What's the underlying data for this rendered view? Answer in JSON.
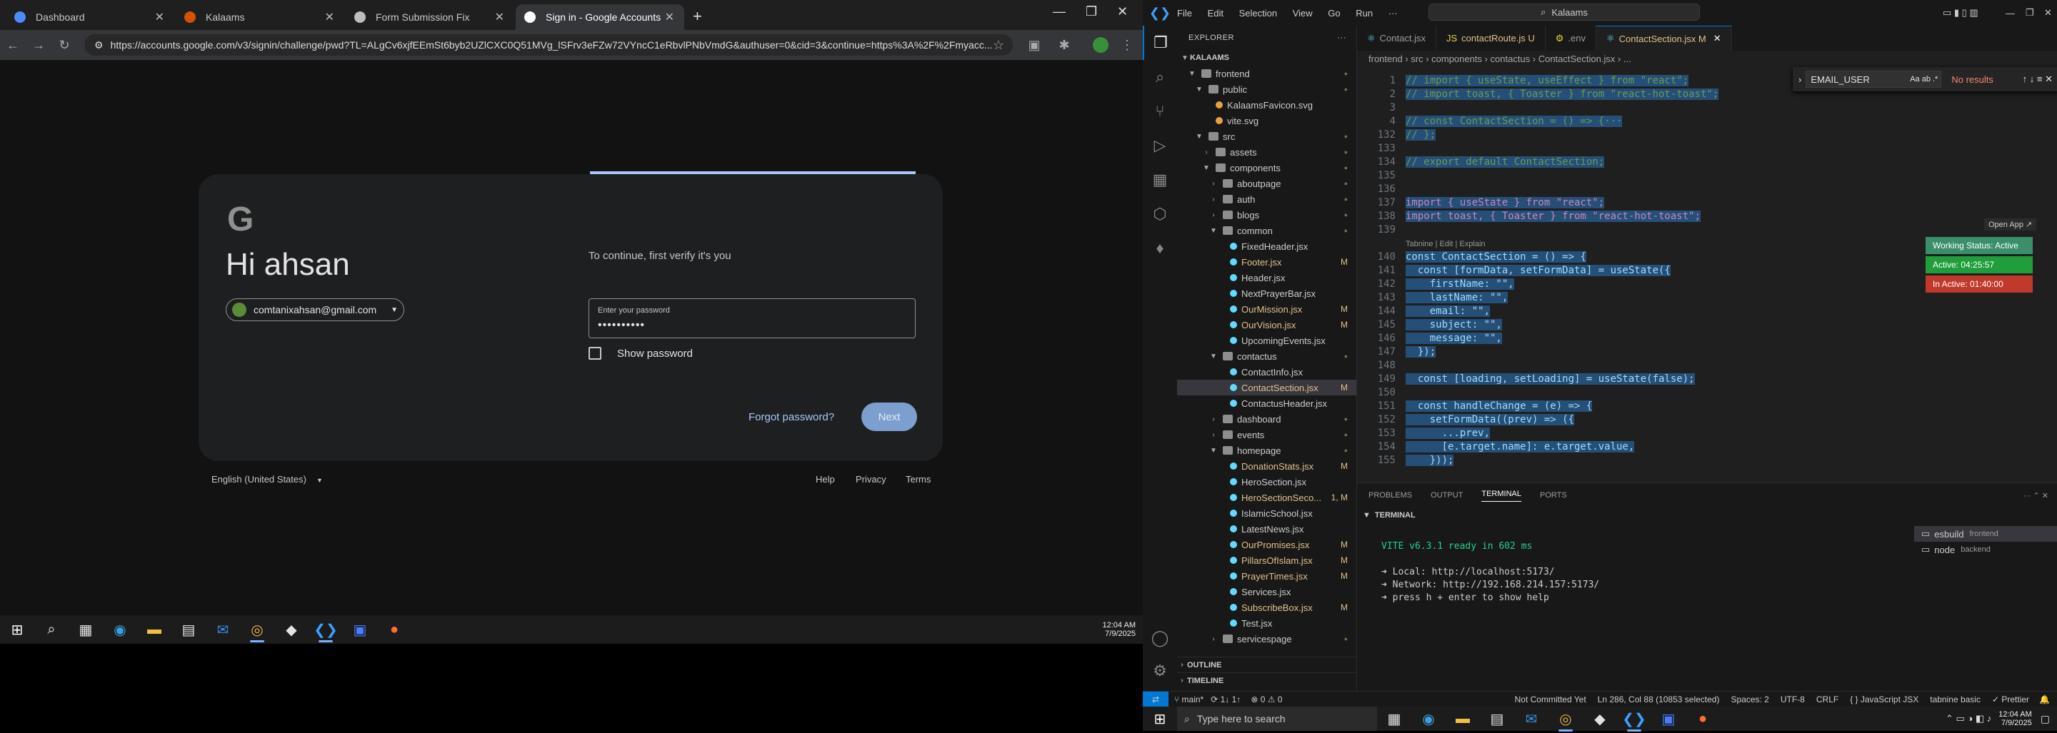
{
  "browser": {
    "tabs": [
      {
        "label": "Dashboard",
        "color": "#4a8cff"
      },
      {
        "label": "Kalaams",
        "color": "#d35400"
      },
      {
        "label": "Form Submission Fix",
        "color": "#bdbdbd"
      },
      {
        "label": "Sign in - Google Accounts",
        "color": "#ffffff"
      }
    ],
    "url": "https://accounts.google.com/v3/signin/challenge/pwd?TL=ALgCv6xjfEEmSt6byb2UZlCXC0Q51MVg_lSFrv3eFZw72VYncC1eRbvlPNbVmdG&authuser=0&cid=3&continue=https%3A%2F%2Fmyacc..."
  },
  "signin": {
    "greeting": "Hi ahsan",
    "email": "comtanixahsan@gmail.com",
    "verify_text": "To continue, first verify it's you",
    "password_label": "Enter your password",
    "password_value": "••••••••••",
    "show_password": "Show password",
    "forgot": "Forgot password?",
    "next": "Next",
    "language": "English (United States)",
    "footer": [
      "Help",
      "Privacy",
      "Terms"
    ]
  },
  "left_clock": {
    "time": "12:04 AM",
    "date": "7/9/2025"
  },
  "vscode": {
    "menu": [
      "File",
      "Edit",
      "Selection",
      "View",
      "Go",
      "Run",
      "···"
    ],
    "search": "Kalaams",
    "explorer_title": "EXPLORER",
    "project": "KALAAMS",
    "tree": [
      {
        "label": "frontend",
        "depth": 1,
        "type": "folder",
        "open": true
      },
      {
        "label": "public",
        "depth": 2,
        "type": "folder",
        "open": true
      },
      {
        "label": "KalaamsFavicon.svg",
        "depth": 3,
        "type": "file"
      },
      {
        "label": "vite.svg",
        "depth": 3,
        "type": "file"
      },
      {
        "label": "src",
        "depth": 2,
        "type": "folder",
        "open": true
      },
      {
        "label": "assets",
        "depth": 3,
        "type": "folder"
      },
      {
        "label": "components",
        "depth": 3,
        "type": "folder",
        "open": true
      },
      {
        "label": "aboutpage",
        "depth": 4,
        "type": "folder"
      },
      {
        "label": "auth",
        "depth": 4,
        "type": "folder"
      },
      {
        "label": "blogs",
        "depth": 4,
        "type": "folder"
      },
      {
        "label": "common",
        "depth": 4,
        "type": "folder",
        "open": true
      },
      {
        "label": "FixedHeader.jsx",
        "depth": 5,
        "type": "file"
      },
      {
        "label": "Footer.jsx",
        "depth": 5,
        "type": "file",
        "mark": "M"
      },
      {
        "label": "Header.jsx",
        "depth": 5,
        "type": "file"
      },
      {
        "label": "NextPrayerBar.jsx",
        "depth": 5,
        "type": "file"
      },
      {
        "label": "OurMission.jsx",
        "depth": 5,
        "type": "file",
        "mark": "M"
      },
      {
        "label": "OurVision.jsx",
        "depth": 5,
        "type": "file",
        "mark": "M"
      },
      {
        "label": "UpcomingEvents.jsx",
        "depth": 5,
        "type": "file"
      },
      {
        "label": "contactus",
        "depth": 4,
        "type": "folder",
        "open": true
      },
      {
        "label": "ContactInfo.jsx",
        "depth": 5,
        "type": "file"
      },
      {
        "label": "ContactSection.jsx",
        "depth": 5,
        "type": "file",
        "mark": "M",
        "selected": true
      },
      {
        "label": "ContactusHeader.jsx",
        "depth": 5,
        "type": "file"
      },
      {
        "label": "dashboard",
        "depth": 4,
        "type": "folder"
      },
      {
        "label": "events",
        "depth": 4,
        "type": "folder"
      },
      {
        "label": "homepage",
        "depth": 4,
        "type": "folder",
        "open": true
      },
      {
        "label": "DonationStats.jsx",
        "depth": 5,
        "type": "file",
        "mark": "M"
      },
      {
        "label": "HeroSection.jsx",
        "depth": 5,
        "type": "file"
      },
      {
        "label": "HeroSectionSeco...",
        "depth": 5,
        "type": "file",
        "mark": "1, M"
      },
      {
        "label": "IslamicSchool.jsx",
        "depth": 5,
        "type": "file"
      },
      {
        "label": "LatestNews.jsx",
        "depth": 5,
        "type": "file"
      },
      {
        "label": "OurPromises.jsx",
        "depth": 5,
        "type": "file",
        "mark": "M"
      },
      {
        "label": "PillarsOfIslam.jsx",
        "depth": 5,
        "type": "file",
        "mark": "M"
      },
      {
        "label": "PrayerTimes.jsx",
        "depth": 5,
        "type": "file",
        "mark": "M"
      },
      {
        "label": "Services.jsx",
        "depth": 5,
        "type": "file"
      },
      {
        "label": "SubscribeBox.jsx",
        "depth": 5,
        "type": "file",
        "mark": "M"
      },
      {
        "label": "Test.jsx",
        "depth": 5,
        "type": "file"
      },
      {
        "label": "servicespage",
        "depth": 4,
        "type": "folder"
      }
    ],
    "outline": "OUTLINE",
    "timeline": "TIMELINE",
    "editor_tabs": [
      {
        "label": "Contact.jsx"
      },
      {
        "label": "contactRoute.js U"
      },
      {
        "label": ".env"
      },
      {
        "label": "ContactSection.jsx M",
        "active": true
      }
    ],
    "breadcrumb": "frontend  ›  src  ›  components  ›  contactus  ›  ContactSection.jsx  ›  ...",
    "find": {
      "query": "EMAIL_USER",
      "result": "No results"
    },
    "code": [
      {
        "n": "1",
        "t": "// import { useState, useEffect } from \"react\";",
        "hl": true
      },
      {
        "n": "2",
        "t": "// import toast, { Toaster } from \"react-hot-toast\";",
        "hl": true
      },
      {
        "n": "3",
        "t": "",
        "hl": false
      },
      {
        "n": "4",
        "t": "// const ContactSection = () => {···",
        "hl": true
      },
      {
        "n": "132",
        "t": "// };",
        "hl": true
      },
      {
        "n": "133",
        "t": "",
        "hl": false
      },
      {
        "n": "134",
        "t": "// export default ContactSection;",
        "hl": true
      },
      {
        "n": "135",
        "t": "",
        "hl": false
      },
      {
        "n": "136",
        "t": "",
        "hl": false
      },
      {
        "n": "137",
        "t": "import { useState } from \"react\";",
        "hl": true
      },
      {
        "n": "138",
        "t": "import toast, { Toaster } from \"react-hot-toast\";",
        "hl": true
      },
      {
        "n": "139",
        "t": "",
        "hl": false
      },
      {
        "n": "",
        "t": "Tabnine | Edit | Explain",
        "hl": false,
        "lens": true
      },
      {
        "n": "140",
        "t": "const ContactSection = () => {",
        "hl": true
      },
      {
        "n": "141",
        "t": "  const [formData, setFormData] = useState({",
        "hl": true
      },
      {
        "n": "142",
        "t": "    firstName: \"\",",
        "hl": true
      },
      {
        "n": "143",
        "t": "    lastName: \"\",",
        "hl": true
      },
      {
        "n": "144",
        "t": "    email: \"\",",
        "hl": true
      },
      {
        "n": "145",
        "t": "    subject: \"\",",
        "hl": true
      },
      {
        "n": "146",
        "t": "    message: \"\",",
        "hl": true
      },
      {
        "n": "147",
        "t": "  });",
        "hl": true
      },
      {
        "n": "148",
        "t": "",
        "hl": false
      },
      {
        "n": "149",
        "t": "  const [loading, setLoading] = useState(false);",
        "hl": true
      },
      {
        "n": "150",
        "t": "",
        "hl": false
      },
      {
        "n": "151",
        "t": "  const handleChange = (e) => {",
        "hl": true
      },
      {
        "n": "152",
        "t": "    setFormData((prev) => ({",
        "hl": true
      },
      {
        "n": "153",
        "t": "      ...prev,",
        "hl": true
      },
      {
        "n": "154",
        "t": "      [e.target.name]: e.target.value,",
        "hl": true
      },
      {
        "n": "155",
        "t": "    }));",
        "hl": true
      }
    ],
    "open_app": "Open App ↗",
    "work_status": [
      {
        "label": "Working Status: Active",
        "color": "#3a8f6a"
      },
      {
        "label": "Active: 04:25:57",
        "color": "#1f9e3a"
      },
      {
        "label": "In Active: 01:40:00",
        "color": "#c0392b"
      }
    ],
    "panel_tabs": [
      "PROBLEMS",
      "OUTPUT",
      "TERMINAL",
      "PORTS"
    ],
    "terminal_label": "TERMINAL",
    "terminal_lines": [
      "VITE v6.3.1  ready in 602 ms",
      "",
      "➜  Local:   http://localhost:5173/",
      "➜  Network: http://192.168.214.157:5173/",
      "➜  press h + enter to show help"
    ],
    "terminal_list": [
      {
        "name": "esbuild",
        "cwd": "frontend"
      },
      {
        "name": "node",
        "cwd": "backend"
      }
    ],
    "status": {
      "branch": "main*",
      "sync": "⟳ 1↓ 1↑",
      "problems": "⊗ 0 ⚠ 0",
      "commit": "Not Committed Yet",
      "position": "Ln 286, Col 88 (10853 selected)",
      "spaces": "Spaces: 2",
      "encoding": "UTF-8",
      "eol": "CRLF",
      "language": "{ } JavaScript JSX",
      "tabnine": "tabnine basic",
      "prettier": "✓ Prettier"
    }
  },
  "right_taskbar": {
    "search_placeholder": "Type here to search",
    "time": "12:04 AM",
    "date": "7/9/2025"
  }
}
